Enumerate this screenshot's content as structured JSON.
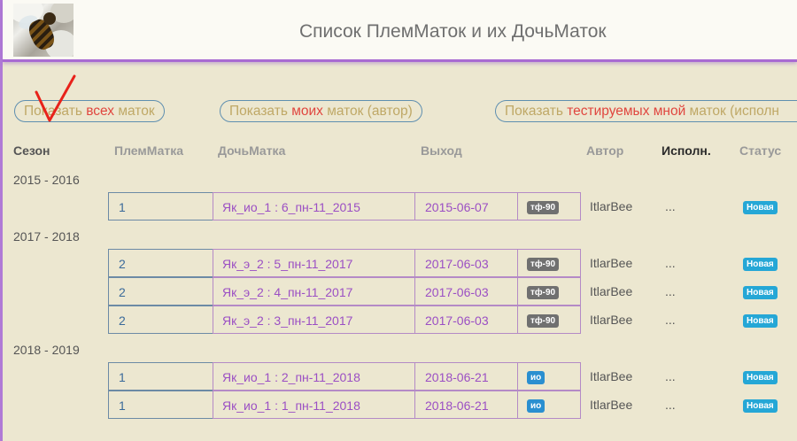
{
  "header": {
    "title": "Список ПлемМаток и их ДочьМаток"
  },
  "filters": {
    "all": {
      "pre": "Показать ",
      "hl": "всех",
      "post": " маток"
    },
    "mine": {
      "pre": "Показать ",
      "hl": "моих",
      "post": " маток (автор)"
    },
    "tested": {
      "pre": "Показать ",
      "hl": "тестируемых мной",
      "post": " маток (исполн"
    }
  },
  "columns": {
    "season": "Сезон",
    "plem": "ПлемМатка",
    "doch": "ДочьМатка",
    "exit": "Выход",
    "author": "Автор",
    "executor": "Исполн.",
    "status": "Статус"
  },
  "seasons": [
    {
      "label": "2015 - 2016",
      "rows": [
        {
          "plem": "1",
          "doch": "Як_ио_1 : 6_пн-11_2015",
          "exit": "2015-06-07",
          "tag": "тф-90",
          "tag_color": "#707070",
          "author": "ItlarBee",
          "executor": "...",
          "status": "Новая"
        }
      ]
    },
    {
      "label": "2017 - 2018",
      "rows": [
        {
          "plem": "2",
          "doch": "Як_э_2 : 5_пн-11_2017",
          "exit": "2017-06-03",
          "tag": "тф-90",
          "tag_color": "#707070",
          "author": "ItlarBee",
          "executor": "...",
          "status": "Новая"
        },
        {
          "plem": "2",
          "doch": "Як_э_2 : 4_пн-11_2017",
          "exit": "2017-06-03",
          "tag": "тф-90",
          "tag_color": "#707070",
          "author": "ItlarBee",
          "executor": "...",
          "status": "Новая"
        },
        {
          "plem": "2",
          "doch": "Як_э_2 : 3_пн-11_2017",
          "exit": "2017-06-03",
          "tag": "тф-90",
          "tag_color": "#707070",
          "author": "ItlarBee",
          "executor": "...",
          "status": "Новая"
        }
      ]
    },
    {
      "label": "2018 - 2019",
      "rows": [
        {
          "plem": "1",
          "doch": "Як_ио_1 : 2_пн-11_2018",
          "exit": "2018-06-21",
          "tag": "ио",
          "tag_color": "#2a8fd0",
          "author": "ItlarBee",
          "executor": "...",
          "status": "Новая"
        },
        {
          "plem": "1",
          "doch": "Як_ио_1 : 1_пн-11_2018",
          "exit": "2018-06-21",
          "tag": "ио",
          "tag_color": "#2a8fd0",
          "author": "ItlarBee",
          "executor": "...",
          "status": "Новая"
        }
      ]
    }
  ],
  "colors": {
    "accent_purple": "#a86ad2",
    "highlight_red": "#e0463f",
    "status_blue": "#25a7d6",
    "link_purple": "#9b4fc4",
    "background": "#ece7d0"
  }
}
